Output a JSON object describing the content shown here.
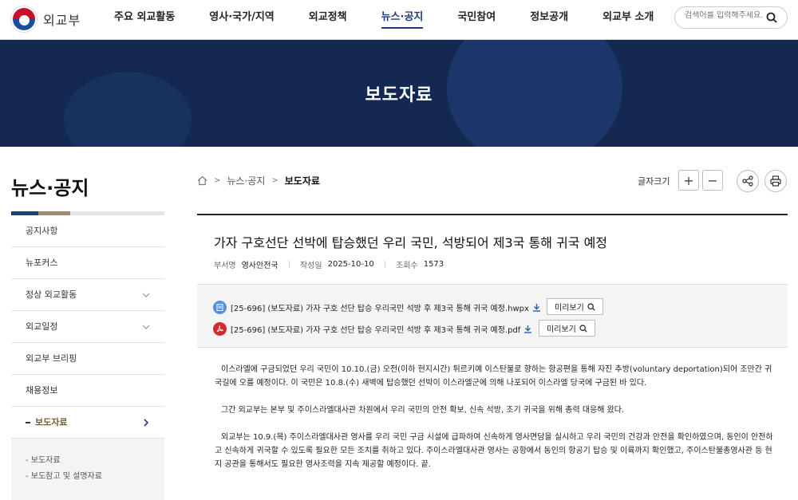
{
  "header": {
    "logo_text": "외교부",
    "nav": [
      "주요 외교활동",
      "영사·국가/지역",
      "외교정책",
      "뉴스·공지",
      "국민참여",
      "정보공개",
      "외교부 소개"
    ],
    "active_nav_index": 3,
    "search_placeholder": "검색어를 입력해주세요."
  },
  "banner": {
    "title": "보도자료"
  },
  "sidebar": {
    "title": "뉴스·공지",
    "items": [
      {
        "label": "공지사항"
      },
      {
        "label": "뉴포커스"
      },
      {
        "label": "정상 외교활동"
      },
      {
        "label": "외교일정"
      },
      {
        "label": "외교부 브리핑"
      },
      {
        "label": "채용정보"
      },
      {
        "label": "보도자료"
      }
    ],
    "sub_items": [
      "- 보도자료",
      "- 보도참고 및 설명자료"
    ]
  },
  "breadcrumb": {
    "items": [
      "뉴스·공지",
      "보도자료"
    ]
  },
  "tools": {
    "font_size_label": "글자크기",
    "plus": "+",
    "minus": "−"
  },
  "article": {
    "title": "가자 구호선단 선박에 탑승했던 우리 국민, 석방되어 제3국 통해 귀국 예정",
    "meta": {
      "dept_label": "부서명",
      "dept_value": "영사안전국",
      "date_label": "작성일",
      "date_value": "2025-10-10",
      "views_label": "조회수",
      "views_value": "1573"
    },
    "files": [
      {
        "name": "[25-696] (보도자료) 가자 구호 선단 탑승 우리국민 석방 후 제3국 통해 귀국 예정.hwpx",
        "preview": "미리보기"
      },
      {
        "name": "[25-696] (보도자료) 가자 구호 선단 탑승 우리국민 석방 후 제3국 통해 귀국 예정.pdf",
        "preview": "미리보기"
      }
    ],
    "paragraphs": [
      "이스라엘에 구금되었던 우리 국민이 10.10.(금) 오전(이하 현지시간) 튀르키예 이스탄불로 향하는 항공편을 통해 자진 추방(voluntary deportation)되어 조만간 귀국길에 오를 예정이다. 이 국민은 10.8.(수) 새벽에 탑승했던 선박이 이스라엘군에 의해 나포되어 이스라엘 당국에 구금된 바 있다.",
      "그간 외교부는 본부 및 주이스라엘대사관 차원에서 우리 국민의 안전 확보, 신속 석방, 조기 귀국을 위해 총력 대응해 왔다.",
      "외교부는 10.9.(목) 주이스라엘대사관 영사를 우리 국민 구금 시설에 급파하여 신속하게 영사면담을 실시하고 우리 국민의 건강과 안전을 확인하였으며, 동인이 안전하고 신속하게 귀국할 수 있도록 필요한 모든 조치를 취하고 있다. 주이스라엘대사관 영사는 공항에서 동인의 항공기 탑승 및 이륙까지 확인했고, 주이스탄불총영사관 등 현지 공관을 통해서도 필요한 영사조력을 지속 제공할 예정이다.  끝."
    ]
  }
}
